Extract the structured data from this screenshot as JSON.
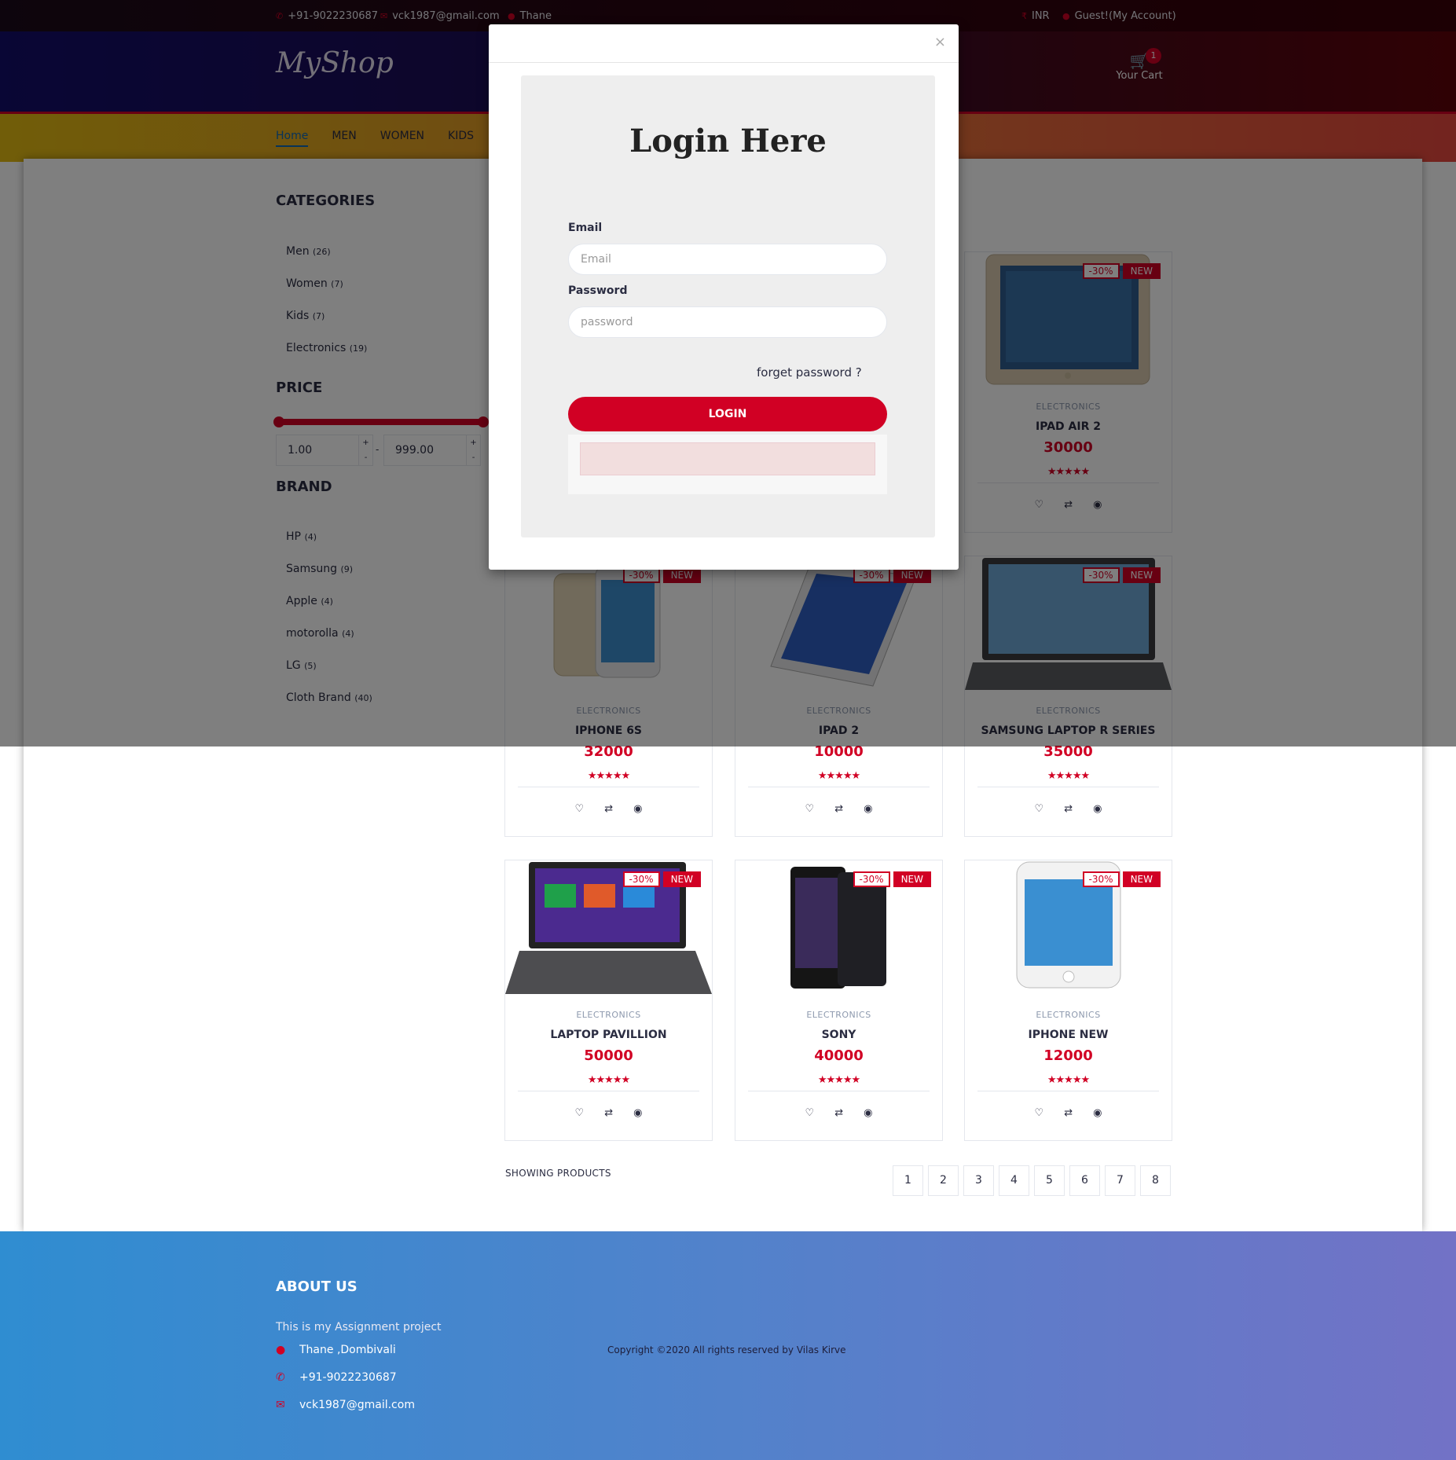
{
  "topbar": {
    "phone": "+91-9022230687",
    "email": "vck1987@gmail.com",
    "location": "Thane",
    "currency": "INR",
    "account": "Guest!(My Account)"
  },
  "header": {
    "logo": "MyShop",
    "cart_label": "Your Cart",
    "cart_qty": "1"
  },
  "nav": [
    "Home",
    "MEN",
    "WOMEN",
    "KIDS"
  ],
  "sidebar": {
    "categories_title": "CATEGORIES",
    "categories": [
      {
        "label": "Men",
        "count": "(26)"
      },
      {
        "label": "Women",
        "count": "(7)"
      },
      {
        "label": "Kids",
        "count": "(7)"
      },
      {
        "label": "Electronics",
        "count": "(19)"
      }
    ],
    "price_title": "PRICE",
    "price_min": "1.00",
    "price_max": "999.00",
    "brand_title": "BRAND",
    "brands": [
      {
        "label": "HP",
        "count": "(4)"
      },
      {
        "label": "Samsung",
        "count": "(9)"
      },
      {
        "label": "Apple",
        "count": "(4)"
      },
      {
        "label": "motorolla",
        "count": "(4)"
      },
      {
        "label": "LG",
        "count": "(5)"
      },
      {
        "label": "Cloth Brand",
        "count": "(40)"
      }
    ]
  },
  "badges": {
    "sale": "-30%",
    "new": "NEW"
  },
  "products": [
    {
      "category": "ELECTRONICS",
      "name": "IPAD AIR 2",
      "price": "30000",
      "rating": "★★★★★"
    },
    {
      "category": "ELECTRONICS",
      "name": "IPHONE 6S",
      "price": "32000",
      "rating": "★★★★★"
    },
    {
      "category": "ELECTRONICS",
      "name": "IPAD 2",
      "price": "10000",
      "rating": "★★★★★"
    },
    {
      "category": "ELECTRONICS",
      "name": "SAMSUNG LAPTOP R SERIES",
      "price": "35000",
      "rating": "★★★★★"
    },
    {
      "category": "ELECTRONICS",
      "name": "LAPTOP PAVILLION",
      "price": "50000",
      "rating": "★★★★★"
    },
    {
      "category": "ELECTRONICS",
      "name": "SONY",
      "price": "40000",
      "rating": "★★★★★"
    },
    {
      "category": "ELECTRONICS",
      "name": "IPHONE NEW",
      "price": "12000",
      "rating": "★★★★★"
    }
  ],
  "icons": {
    "wishlist": "heart-icon",
    "compare": "exchange-icon",
    "quickview": "eye-icon"
  },
  "showing_label": "SHOWING PRODUCTS",
  "pages": [
    "1",
    "2",
    "3",
    "4",
    "5",
    "6",
    "7",
    "8"
  ],
  "footer": {
    "about_title": "ABOUT US",
    "about_text": "This is my Assignment project",
    "address": "Thane ,Dombivali",
    "phone": "+91-9022230687",
    "email": "vck1987@gmail.com",
    "copyright": "Copyright ©2020 All rights reserved by Vilas Kirve"
  },
  "modal": {
    "title": "Login Here",
    "email_label": "Email",
    "email_placeholder": "Email",
    "password_label": "Password",
    "password_placeholder": "password",
    "forget": "forget password ?",
    "login_button": "LOGIN",
    "close": "×"
  },
  "colors": {
    "accent": "#d10024",
    "link": "#1167b1"
  }
}
